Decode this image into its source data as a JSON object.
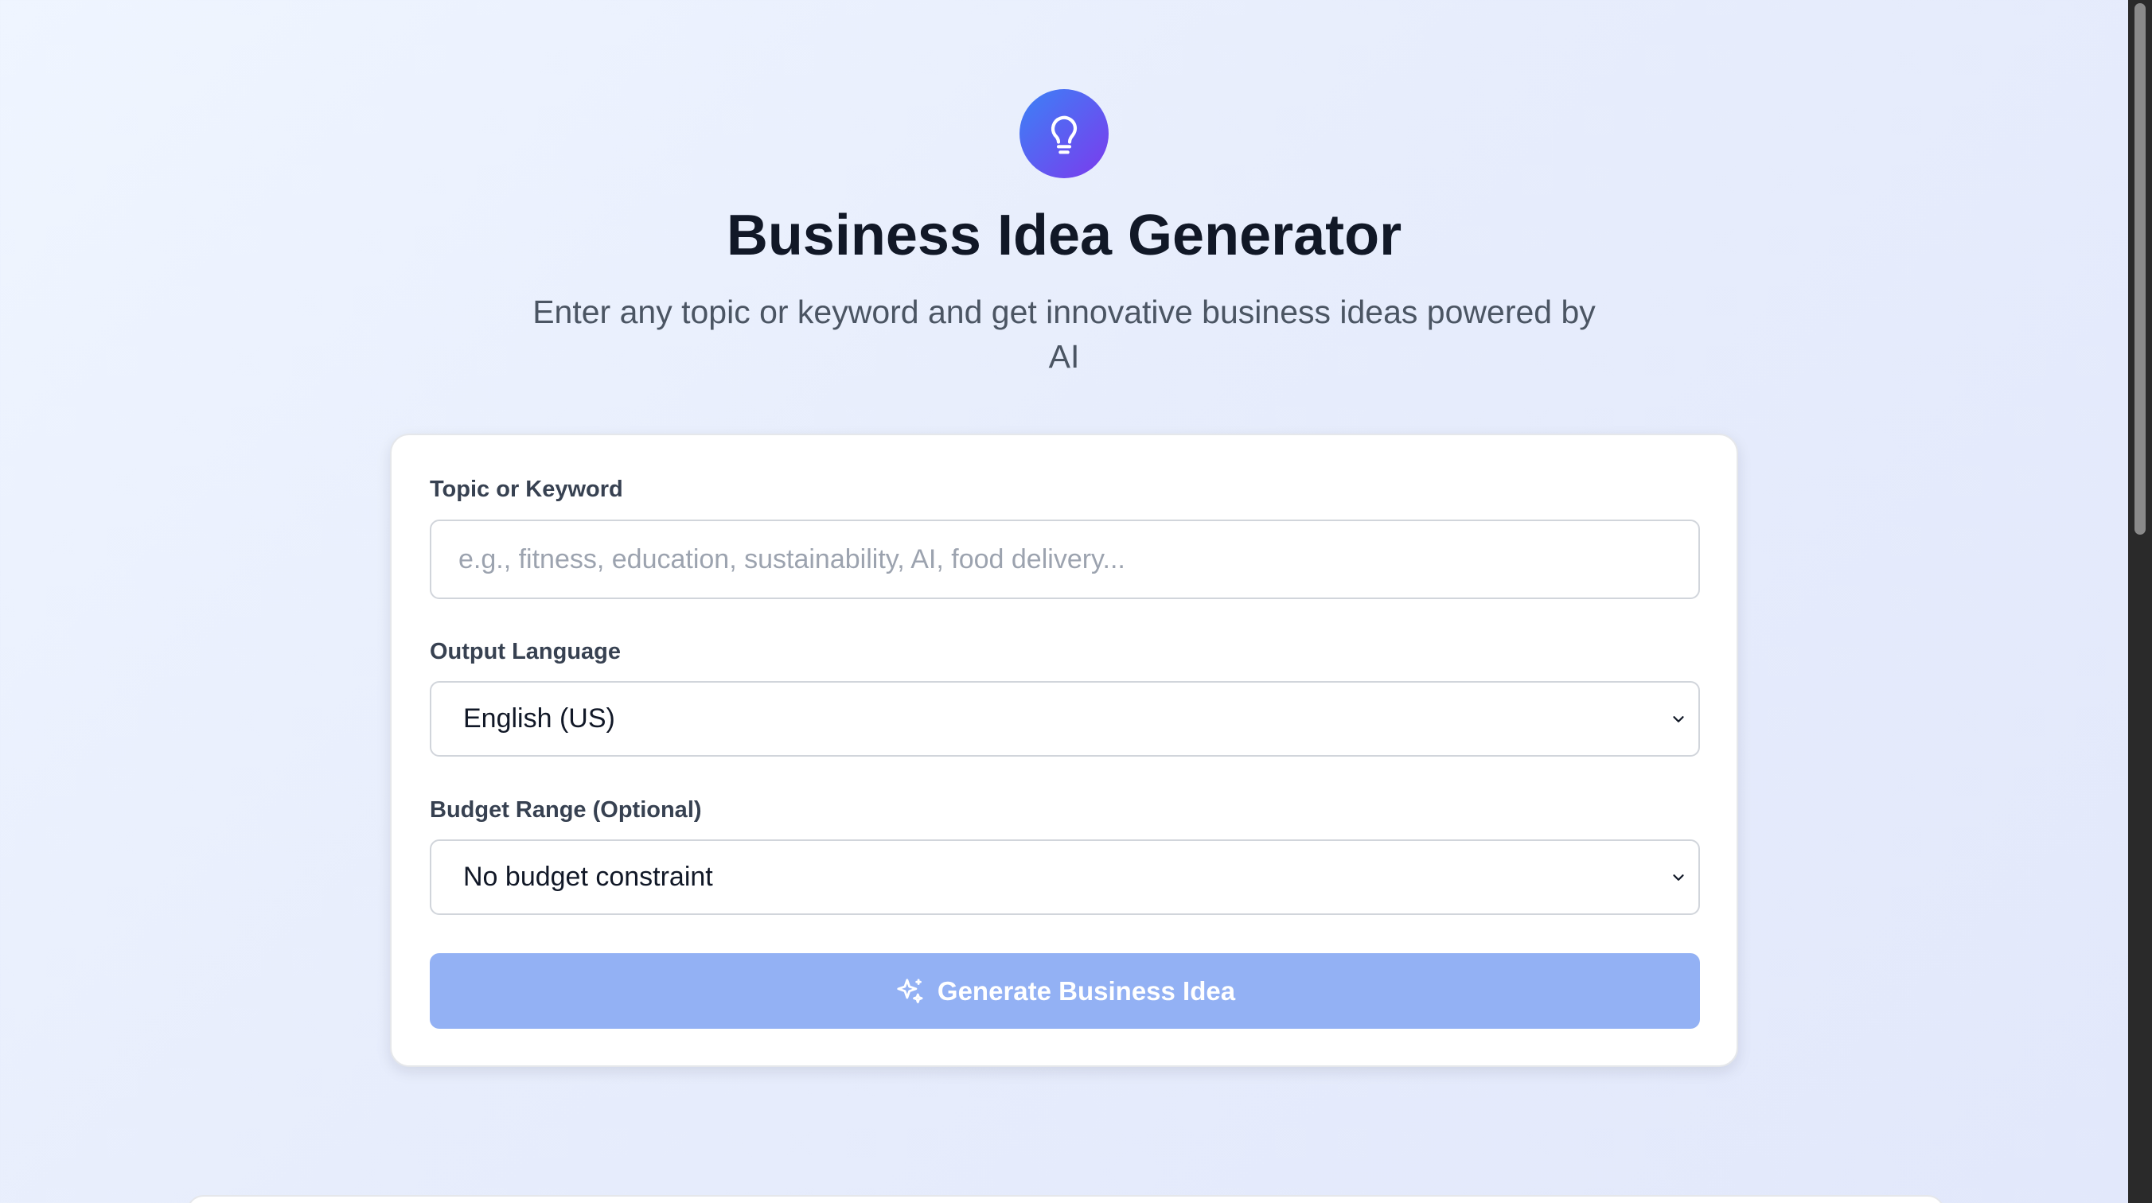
{
  "header": {
    "logo_icon": "lightbulb-icon",
    "title": "Business Idea Generator",
    "subtitle": "Enter any topic or keyword and get innovative business ideas powered by AI"
  },
  "form": {
    "topic": {
      "label": "Topic or Keyword",
      "placeholder": "e.g., fitness, education, sustainability, AI, food delivery...",
      "value": ""
    },
    "language": {
      "label": "Output Language",
      "selected": "English (US)"
    },
    "budget": {
      "label": "Budget Range (Optional)",
      "selected": "No budget constraint"
    },
    "submit": {
      "label": "Generate Business Idea",
      "icon": "sparkles-icon",
      "state": "disabled"
    }
  },
  "colors": {
    "accent_gradient_start": "#3b82f6",
    "accent_gradient_end": "#7c3aed",
    "button_disabled": "#93b1f4",
    "title_text": "#111827",
    "subtitle_text": "#4b5563"
  }
}
